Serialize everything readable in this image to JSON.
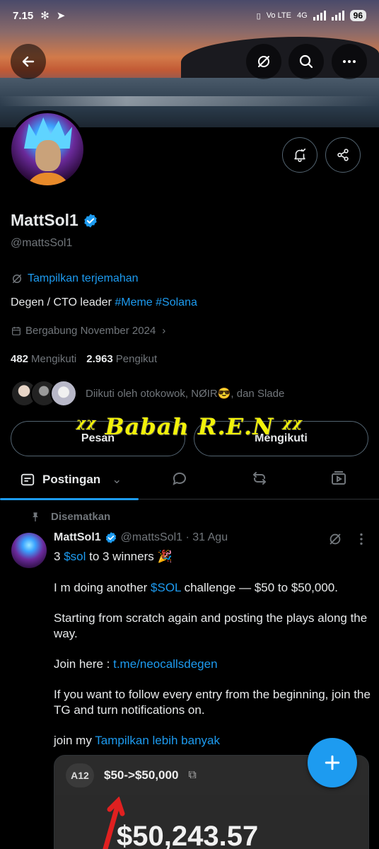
{
  "status": {
    "time": "7.15",
    "network": "Vo LTE",
    "net_type": "4G",
    "battery": "96"
  },
  "profile": {
    "name": "MattSol1",
    "handle": "@mattsSol1",
    "translate": "Tampilkan terjemahan",
    "bio_text": "Degen / CTO leader",
    "bio_tags": [
      "#Meme",
      "#Solana"
    ],
    "joined": "Bergabung November 2024",
    "following_count": "482",
    "following_label": "Mengikuti",
    "followers_count": "2.963",
    "followers_label": "Pengikut",
    "followed_by": "Diikuti oleh otokowok, NØIR😎, dan Slade",
    "message_button": "Pesan",
    "follow_button": "Mengikuti"
  },
  "overlay": {
    "text": "ᵡᵡ Babah R.E.N ᵡᵡ"
  },
  "tabs": {
    "active_label": "Postingan"
  },
  "post": {
    "pinned_label": "Disematkan",
    "author": "MattSol1",
    "handle_date": "@mattsSol1 · 31 Agu",
    "line1_pre": "3 ",
    "line1_tag": "$sol",
    "line1_post": " to 3 winners 🎉",
    "p1_pre": "I m doing another ",
    "p1_tag": "$SOL",
    "p1_post": " challenge — $50 to $50,000.",
    "p2": "Starting from scratch again and posting the plays along the way.",
    "p3_pre": "Join here : ",
    "p3_link": "t.me/neocallsdegen",
    "p4": "If you want to follow every entry from the beginning, join the TG and turn notifications on.",
    "p5_pre": "join my ",
    "p5_link": "Tampilkan lebih banyak",
    "media": {
      "badge": "A12",
      "title": "$50->$50,000",
      "amount": "$50,243.57"
    }
  },
  "icons": {
    "back": "arrow-left-icon",
    "translate": "translate-icon",
    "search": "search-icon",
    "more": "more-icon",
    "notify": "bell-icon",
    "share": "share-icon",
    "fab": "plus-icon"
  },
  "colors": {
    "accent": "#1d9bf0",
    "background": "#000000",
    "muted": "#71767b",
    "overlay": "#f2f20a"
  }
}
